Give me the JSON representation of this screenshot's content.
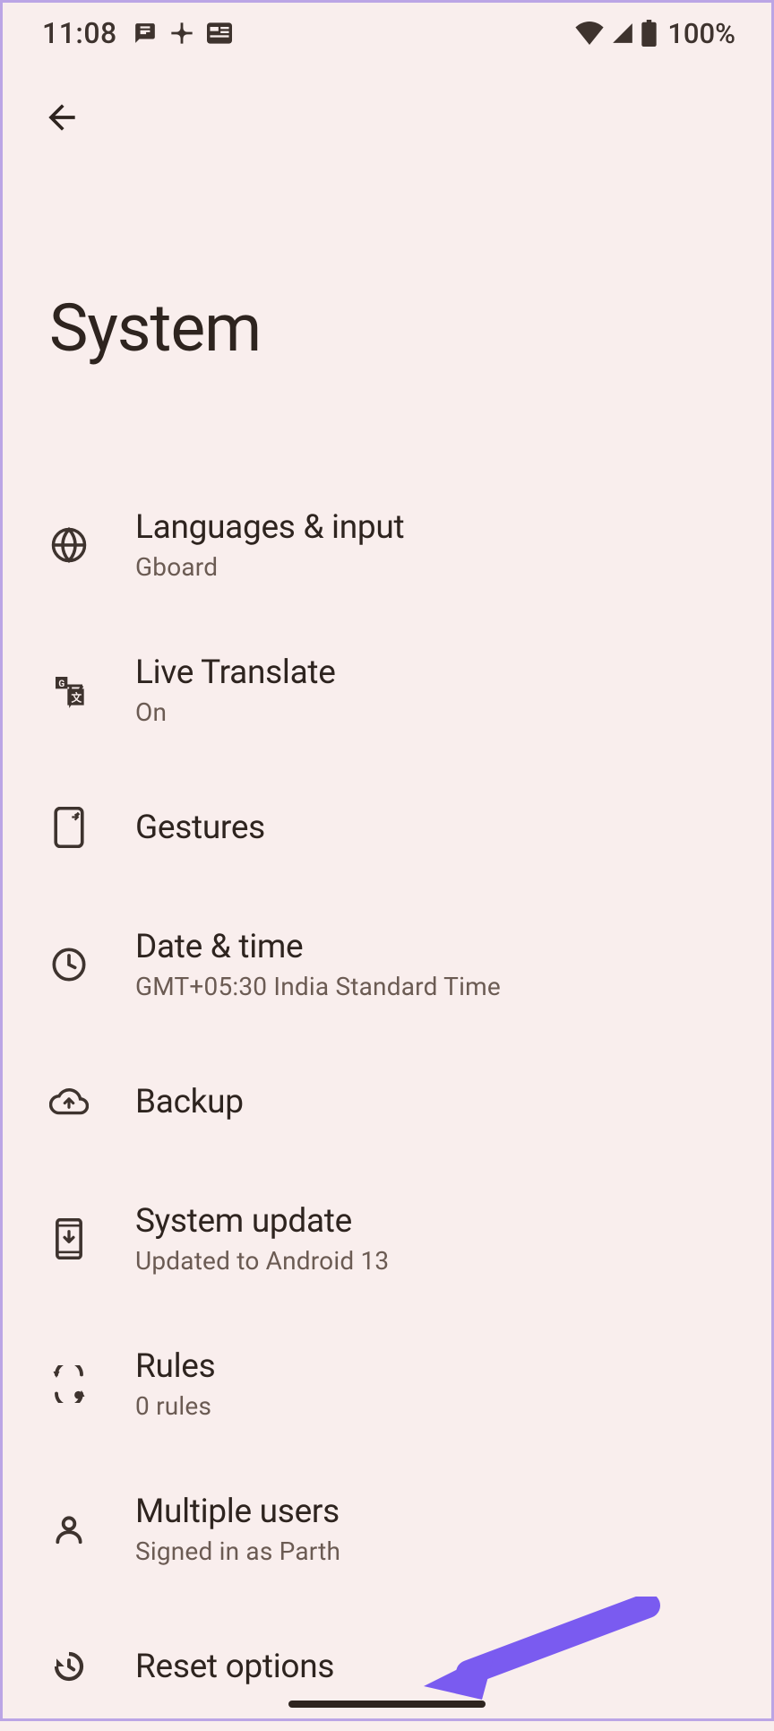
{
  "status": {
    "time": "11:08",
    "battery_text": "100%"
  },
  "page": {
    "title": "System"
  },
  "items": [
    {
      "title": "Languages & input",
      "sub": "Gboard"
    },
    {
      "title": "Live Translate",
      "sub": "On"
    },
    {
      "title": "Gestures",
      "sub": ""
    },
    {
      "title": "Date & time",
      "sub": "GMT+05:30 India Standard Time"
    },
    {
      "title": "Backup",
      "sub": ""
    },
    {
      "title": "System update",
      "sub": "Updated to Android 13"
    },
    {
      "title": "Rules",
      "sub": "0 rules"
    },
    {
      "title": "Multiple users",
      "sub": "Signed in as Parth"
    },
    {
      "title": "Reset options",
      "sub": ""
    }
  ]
}
